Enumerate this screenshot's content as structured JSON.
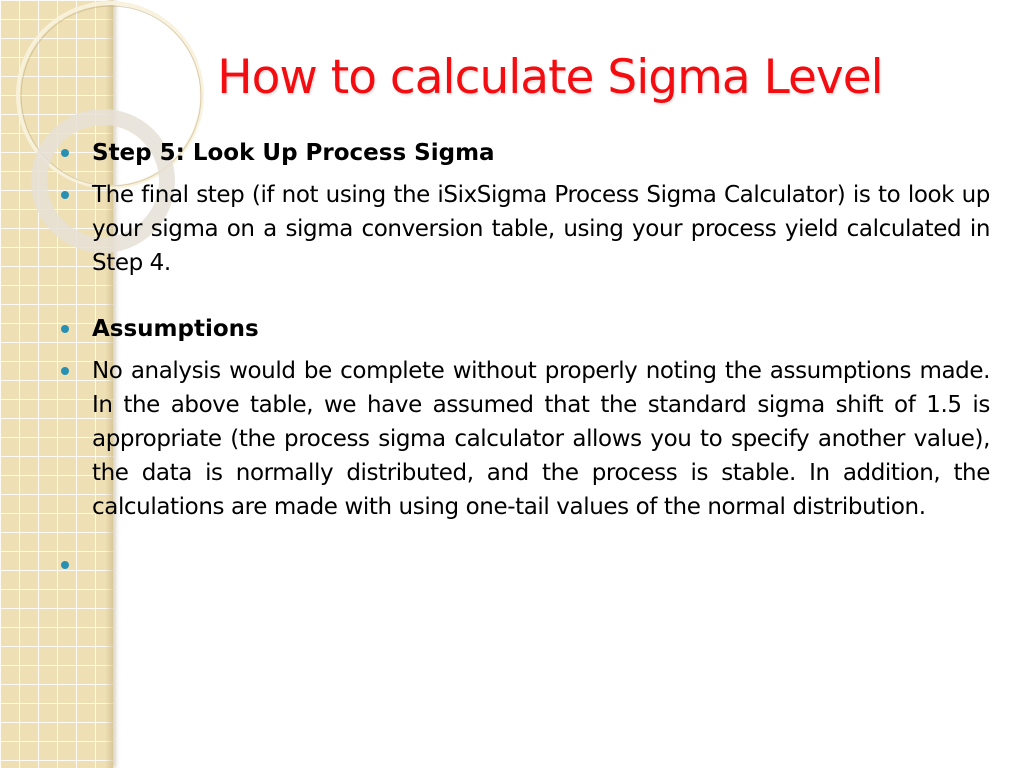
{
  "slide": {
    "title": "How to calculate Sigma Level",
    "colors": {
      "title": "#f40d10",
      "bullet": "#2a90b2",
      "strip": "#eedfb4",
      "text": "#000000"
    },
    "bullets": [
      {
        "type": "heading",
        "text": "Step 5: Look Up Process Sigma"
      },
      {
        "type": "body",
        "text": "The final step (if not using the iSixSigma Process Sigma Calculator) is to look up your sigma on a sigma conversion table, using your process yield calculated in Step 4."
      },
      {
        "type": "heading",
        "text": "Assumptions"
      },
      {
        "type": "body",
        "text": "No analysis would be complete without properly noting the assumptions made. In the above table, we have assumed that the standard sigma shift of 1.5 is appropriate (the process sigma calculator allows you to specify another value), the data is normally distributed, and the process is stable. In addition, the calculations are made with using one-tail values of the normal distribution."
      },
      {
        "type": "empty",
        "text": ""
      }
    ]
  }
}
